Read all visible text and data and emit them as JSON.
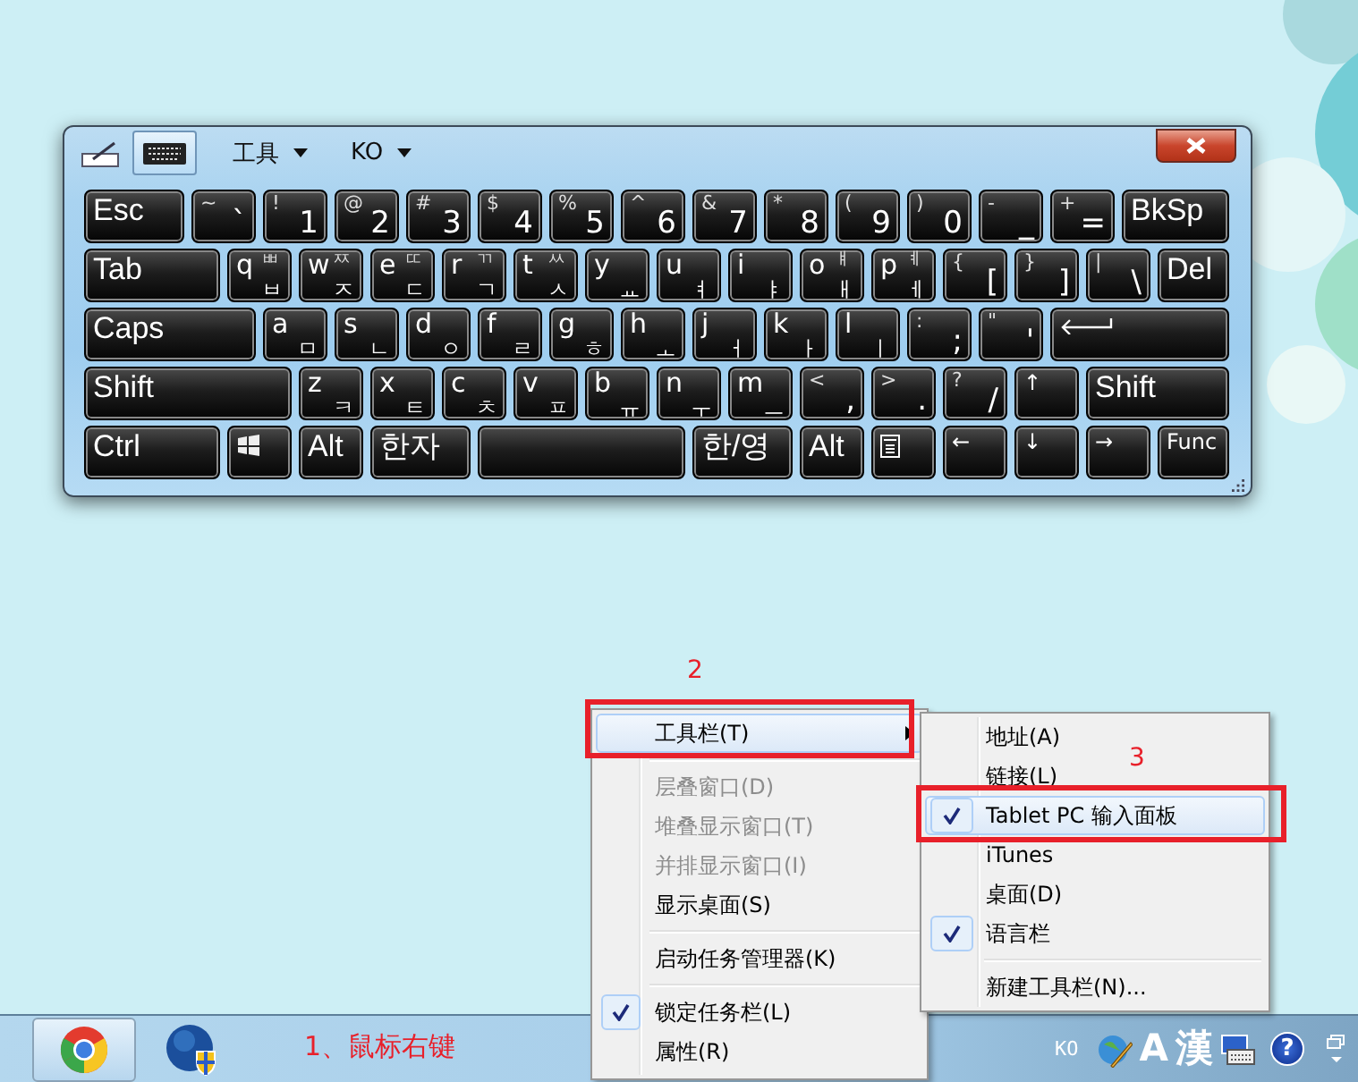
{
  "keyboard_window": {
    "modes": [
      {
        "kind": "pen",
        "selected": false
      },
      {
        "kind": "keyboard",
        "selected": true
      }
    ],
    "menus": [
      {
        "label": "工具"
      },
      {
        "label": "KO"
      }
    ],
    "key_rows": [
      {
        "keys": [
          {
            "kind": "label",
            "label": "Esc"
          },
          {
            "kind": "symbol",
            "shift": "~",
            "main": "`"
          },
          {
            "kind": "symbol",
            "shift": "!",
            "main": "1"
          },
          {
            "kind": "symbol",
            "shift": "@",
            "main": "2"
          },
          {
            "kind": "symbol",
            "shift": "#",
            "main": "3"
          },
          {
            "kind": "symbol",
            "shift": "$",
            "main": "4"
          },
          {
            "kind": "symbol",
            "shift": "%",
            "main": "5"
          },
          {
            "kind": "symbol",
            "shift": "^",
            "main": "6"
          },
          {
            "kind": "symbol",
            "shift": "&",
            "main": "7"
          },
          {
            "kind": "symbol",
            "shift": "*",
            "main": "8"
          },
          {
            "kind": "symbol",
            "shift": "(",
            "main": "9"
          },
          {
            "kind": "symbol",
            "shift": ")",
            "main": "0"
          },
          {
            "kind": "symbol",
            "shift": "-",
            "main": "_"
          },
          {
            "kind": "symbol",
            "shift": "+",
            "main": "="
          },
          {
            "kind": "label",
            "label": "BkSp"
          }
        ]
      },
      {
        "keys": [
          {
            "kind": "label",
            "label": "Tab"
          },
          {
            "kind": "letter",
            "main": "q",
            "hangul_shift": "ㅃ",
            "hangul": "ㅂ"
          },
          {
            "kind": "letter",
            "main": "w",
            "hangul_shift": "ㅉ",
            "hangul": "ㅈ"
          },
          {
            "kind": "letter",
            "main": "e",
            "hangul_shift": "ㄸ",
            "hangul": "ㄷ"
          },
          {
            "kind": "letter",
            "main": "r",
            "hangul_shift": "ㄲ",
            "hangul": "ㄱ"
          },
          {
            "kind": "letter",
            "main": "t",
            "hangul_shift": "ㅆ",
            "hangul": "ㅅ"
          },
          {
            "kind": "letter",
            "main": "y",
            "hangul": "ㅛ"
          },
          {
            "kind": "letter",
            "main": "u",
            "hangul": "ㅕ"
          },
          {
            "kind": "letter",
            "main": "i",
            "hangul": "ㅑ"
          },
          {
            "kind": "letter",
            "main": "o",
            "hangul_shift": "ㅒ",
            "hangul": "ㅐ"
          },
          {
            "kind": "letter",
            "main": "p",
            "hangul_shift": "ㅖ",
            "hangul": "ㅔ"
          },
          {
            "kind": "symbol",
            "shift": "{",
            "main": "["
          },
          {
            "kind": "symbol",
            "shift": "}",
            "main": "]"
          },
          {
            "kind": "symbol",
            "shift": "|",
            "main": "\\"
          },
          {
            "kind": "label",
            "label": "Del"
          }
        ]
      },
      {
        "keys": [
          {
            "kind": "label",
            "label": "Caps"
          },
          {
            "kind": "letter",
            "main": "a",
            "hangul": "ㅁ"
          },
          {
            "kind": "letter",
            "main": "s",
            "hangul": "ㄴ"
          },
          {
            "kind": "letter",
            "main": "d",
            "hangul": "ㅇ"
          },
          {
            "kind": "letter",
            "main": "f",
            "hangul": "ㄹ"
          },
          {
            "kind": "letter",
            "main": "g",
            "hangul": "ㅎ"
          },
          {
            "kind": "letter",
            "main": "h",
            "hangul": "ㅗ"
          },
          {
            "kind": "letter",
            "main": "j",
            "hangul": "ㅓ"
          },
          {
            "kind": "letter",
            "main": "k",
            "hangul": "ㅏ"
          },
          {
            "kind": "letter",
            "main": "l",
            "hangul": "ㅣ"
          },
          {
            "kind": "symbol",
            "shift": ":",
            "main": ";"
          },
          {
            "kind": "symbol",
            "shift": "\"",
            "main": "'"
          },
          {
            "kind": "enter"
          }
        ]
      },
      {
        "keys": [
          {
            "kind": "label",
            "label": "Shift"
          },
          {
            "kind": "letter",
            "main": "z",
            "hangul": "ㅋ"
          },
          {
            "kind": "letter",
            "main": "x",
            "hangul": "ㅌ"
          },
          {
            "kind": "letter",
            "main": "c",
            "hangul": "ㅊ"
          },
          {
            "kind": "letter",
            "main": "v",
            "hangul": "ㅍ"
          },
          {
            "kind": "letter",
            "main": "b",
            "hangul": "ㅠ"
          },
          {
            "kind": "letter",
            "main": "n",
            "hangul": "ㅜ"
          },
          {
            "kind": "letter",
            "main": "m",
            "hangul": "ㅡ"
          },
          {
            "kind": "symbol",
            "shift": "<",
            "main": ","
          },
          {
            "kind": "symbol",
            "shift": ">",
            "main": "."
          },
          {
            "kind": "symbol",
            "shift": "?",
            "main": "/"
          },
          {
            "kind": "small",
            "label": "↑"
          },
          {
            "kind": "label",
            "label": "Shift"
          }
        ]
      },
      {
        "keys": [
          {
            "kind": "label",
            "label": "Ctrl"
          },
          {
            "kind": "windows"
          },
          {
            "kind": "label",
            "label": "Alt"
          },
          {
            "kind": "label",
            "label": "한자"
          },
          {
            "kind": "space"
          },
          {
            "kind": "label",
            "label": "한/영"
          },
          {
            "kind": "label",
            "label": "Alt"
          },
          {
            "kind": "menu"
          },
          {
            "kind": "small",
            "label": "←"
          },
          {
            "kind": "small",
            "label": "↓"
          },
          {
            "kind": "small",
            "label": "→"
          },
          {
            "kind": "small",
            "label": "Func"
          }
        ]
      }
    ]
  },
  "context_menu": {
    "items": [
      {
        "kind": "item",
        "label": "工具栏(T)",
        "submenu": true,
        "selected": true,
        "disabled": false,
        "checked": false
      },
      {
        "kind": "separator"
      },
      {
        "kind": "item",
        "label": "层叠窗口(D)",
        "submenu": false,
        "selected": false,
        "disabled": true,
        "checked": false
      },
      {
        "kind": "item",
        "label": "堆叠显示窗口(T)",
        "submenu": false,
        "selected": false,
        "disabled": true,
        "checked": false
      },
      {
        "kind": "item",
        "label": "并排显示窗口(I)",
        "submenu": false,
        "selected": false,
        "disabled": true,
        "checked": false
      },
      {
        "kind": "item",
        "label": "显示桌面(S)",
        "submenu": false,
        "selected": false,
        "disabled": false,
        "checked": false
      },
      {
        "kind": "separator"
      },
      {
        "kind": "item",
        "label": "启动任务管理器(K)",
        "submenu": false,
        "selected": false,
        "disabled": false,
        "checked": false
      },
      {
        "kind": "separator"
      },
      {
        "kind": "item",
        "label": "锁定任务栏(L)",
        "submenu": false,
        "selected": false,
        "disabled": false,
        "checked": true
      },
      {
        "kind": "item",
        "label": "属性(R)",
        "submenu": false,
        "selected": false,
        "disabled": false,
        "checked": false
      }
    ]
  },
  "submenu": {
    "items": [
      {
        "kind": "item",
        "label": "地址(A)",
        "submenu": false,
        "selected": false,
        "disabled": false,
        "checked": false
      },
      {
        "kind": "item",
        "label": "链接(L)",
        "submenu": false,
        "selected": false,
        "disabled": false,
        "checked": false
      },
      {
        "kind": "item",
        "label": "Tablet PC 输入面板",
        "submenu": false,
        "selected": true,
        "disabled": false,
        "checked": true
      },
      {
        "kind": "item",
        "label": "iTunes",
        "submenu": false,
        "selected": false,
        "disabled": false,
        "checked": false
      },
      {
        "kind": "item",
        "label": "桌面(D)",
        "submenu": false,
        "selected": false,
        "disabled": false,
        "checked": false
      },
      {
        "kind": "item",
        "label": "语言栏",
        "submenu": false,
        "selected": false,
        "disabled": false,
        "checked": true
      },
      {
        "kind": "separator"
      },
      {
        "kind": "item",
        "label": "新建工具栏(N)...",
        "submenu": false,
        "selected": false,
        "disabled": false,
        "checked": false
      }
    ]
  },
  "taskbar": {
    "buttons": [
      {
        "kind": "browser",
        "selected": true
      },
      {
        "kind": "globe",
        "selected": false
      }
    ],
    "tray": [
      {
        "kind": "text",
        "text": "KO"
      },
      {
        "kind": "globe-pen"
      },
      {
        "kind": "glyph",
        "text": "A"
      },
      {
        "kind": "glyph",
        "text": "漢"
      },
      {
        "kind": "keyboard"
      },
      {
        "kind": "help",
        "text": "?"
      },
      {
        "kind": "restore"
      }
    ]
  },
  "annotations": [
    {
      "kind": "note",
      "text": "1、鼠标右键"
    },
    {
      "kind": "number",
      "text": "2"
    },
    {
      "kind": "frame"
    },
    {
      "kind": "number",
      "text": "3"
    },
    {
      "kind": "frame"
    }
  ]
}
